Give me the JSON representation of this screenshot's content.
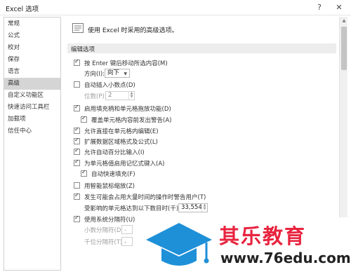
{
  "window": {
    "title": "Excel 选项",
    "help_label": "?",
    "close_label": "✕"
  },
  "sidebar": {
    "items": [
      {
        "label": "常规"
      },
      {
        "label": "公式"
      },
      {
        "label": "校对"
      },
      {
        "label": "保存"
      },
      {
        "label": "语言"
      },
      {
        "label": "高级"
      },
      {
        "label": "自定义功能区"
      },
      {
        "label": "快速访问工具栏"
      },
      {
        "label": "加载项"
      },
      {
        "label": "信任中心"
      }
    ],
    "active": "高级"
  },
  "main": {
    "header": "使用 Excel 时采用的高级选项。",
    "section_title": "编辑选项",
    "options": {
      "move_after_enter": {
        "label": "按 Enter 键后移动所选内容(M)",
        "checked": true
      },
      "direction": {
        "label": "方向(I):",
        "value": "向下"
      },
      "auto_decimal": {
        "label": "自动插入小数点(D)",
        "checked": false
      },
      "places": {
        "label": "位数(P):",
        "value": "2"
      },
      "fill_handle": {
        "label": "启用填充柄和单元格拖放功能(D)",
        "checked": true
      },
      "overwrite_alert": {
        "label": "覆盖单元格内容前发出警告(A)",
        "checked": true
      },
      "edit_in_cell": {
        "label": "允许直接在单元格内编辑(E)",
        "checked": true
      },
      "extend_formats": {
        "label": "扩展数据区域格式及公式(L)",
        "checked": true
      },
      "auto_percent": {
        "label": "允许自动百分比输入(I)",
        "checked": true
      },
      "autocomplete": {
        "label": "为单元格值启用记忆式键入(A)",
        "checked": true
      },
      "flash_fill": {
        "label": "自动快速填充(F)",
        "checked": true
      },
      "zoom_roll": {
        "label": "用智能鼠标缩放(Z)",
        "checked": false
      },
      "warn_slow": {
        "label": "发生可能会占用大量时间的操作时警告用户(T)",
        "checked": true
      },
      "cells_affected": {
        "label": "受影响的单元格达到以下数目时(千)(U):",
        "value": "33,554"
      },
      "system_separators": {
        "label": "使用系统分隔符(U)",
        "checked": true
      },
      "decimal_separator": {
        "label": "小数分隔符(D):",
        "value": "."
      },
      "thousands_separator": {
        "label": "千位分隔符(T):",
        "value": ","
      }
    }
  },
  "watermark": {
    "brand": "其乐教育",
    "url": "www.76edu.com"
  },
  "colors": {
    "active_nav": "#d5d5d5",
    "section_bg": "#ededed",
    "watermark_red": "#e8243f",
    "watermark_blue": "#1e90d8"
  }
}
